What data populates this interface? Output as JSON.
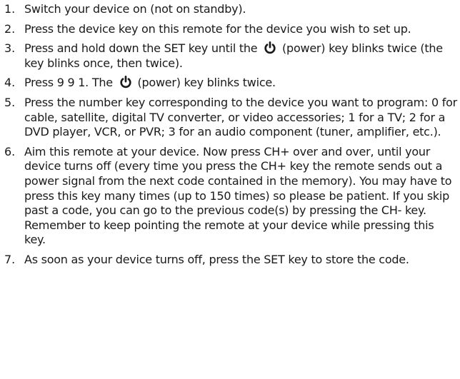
{
  "steps": [
    {
      "number": "1.",
      "text": "Switch your device on (not on standby)."
    },
    {
      "number": "2.",
      "text": "Press the device key on this remote for the device you wish to set up."
    },
    {
      "number": "3.",
      "text_before_icon": "Press and hold down the SET key until the",
      "icon": "power-icon",
      "text_after_icon": "(power) key blinks twice (the key blinks once, then twice)."
    },
    {
      "number": "4.",
      "text_before_icon": "Press 9 9 1. The",
      "icon": "power-icon",
      "text_after_icon": "(power) key blinks twice."
    },
    {
      "number": "5.",
      "text": "Press the number key corresponding to the device you want to program: 0 for cable, satellite, digital TV converter, or video accessories; 1 for a TV; 2 for a DVD player, VCR, or PVR; 3 for an audio component (tuner, amplifier, etc.)."
    },
    {
      "number": "6.",
      "text": "Aim this remote at your device. Now press CH+ over and over, until your device turns off (every time you press the CH+ key the remote sends out a power signal from the next code contained in the memory). You may have to press this key many times (up to 150 times) so please be patient. If you skip past a code, you can go to the previous code(s) by pressing the CH- key. Remember to keep pointing the remote at your device while pressing this key."
    },
    {
      "number": "7.",
      "text": "As soon as your device turns off, press the SET key to store the code."
    }
  ],
  "colors": {
    "text": "#1a1a1a",
    "background": "#ffffff"
  }
}
